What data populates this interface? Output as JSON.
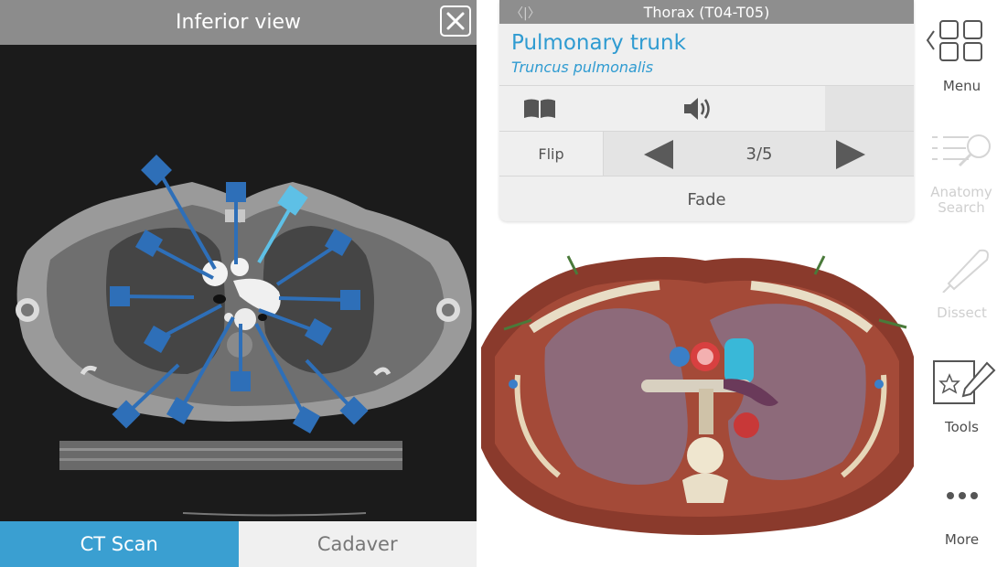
{
  "ct_panel": {
    "title": "Inferior view",
    "tabs": [
      {
        "label": "CT Scan",
        "active": true
      },
      {
        "label": "Cadaver",
        "active": false
      }
    ],
    "accent_color": "#3a9fd1"
  },
  "info_card": {
    "region": "Thorax (T04-T05)",
    "structure_name": "Pulmonary trunk",
    "structure_latin": "Truncus pulmonalis",
    "flip_label": "Flip",
    "page_indicator": "3/5",
    "fade_label": "Fade"
  },
  "toolbar": {
    "items": [
      {
        "label": "Menu",
        "icon": "grid-menu-icon",
        "enabled": true
      },
      {
        "label": "Anatomy Search",
        "icon": "search-list-icon",
        "enabled": false
      },
      {
        "label": "Dissect",
        "icon": "scalpel-icon",
        "enabled": false
      },
      {
        "label": "Tools",
        "icon": "star-pencil-icon",
        "enabled": true
      },
      {
        "label": "More",
        "icon": "more-dots-icon",
        "enabled": true
      }
    ]
  }
}
